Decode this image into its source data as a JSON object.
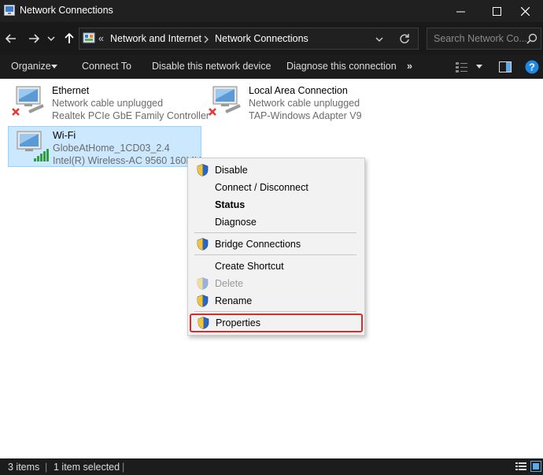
{
  "window": {
    "title": "Network Connections",
    "icon": "network-connections-icon",
    "controls": [
      "minimize-icon",
      "maximize-icon",
      "close-icon"
    ]
  },
  "address_bar": {
    "overflow": "«",
    "crumbs": [
      "Network and Internet",
      "Network Connections"
    ],
    "search_placeholder": "Search Network Co..."
  },
  "toolbar": {
    "organize": "Organize",
    "connect_to": "Connect To",
    "disable": "Disable this network device",
    "diagnose": "Diagnose this connection",
    "more": "»"
  },
  "items": [
    {
      "name": "Ethernet",
      "status": "Network cable unplugged",
      "adapter": "Realtek PCIe GbE Family Controller",
      "state": "disconnected"
    },
    {
      "name": "Local Area Connection",
      "status": "Network cable unplugged",
      "adapter": "TAP-Windows Adapter V9",
      "state": "disconnected"
    },
    {
      "name": "Wi-Fi",
      "status": "GlobeAtHome_1CD03_2.4",
      "adapter": "Intel(R) Wireless-AC 9560 160MHz",
      "state": "connected",
      "selected": true
    }
  ],
  "context_menu": {
    "items": [
      {
        "label": "Disable",
        "icon": "shield-icon"
      },
      {
        "label": "Connect / Disconnect"
      },
      {
        "label": "Status",
        "bold": true
      },
      {
        "label": "Diagnose"
      },
      {
        "label": "Bridge Connections",
        "icon": "shield-icon"
      },
      {
        "label": "Create Shortcut"
      },
      {
        "label": "Delete",
        "icon": "shield-icon",
        "disabled": true
      },
      {
        "label": "Rename",
        "icon": "shield-icon"
      },
      {
        "label": "Properties",
        "icon": "shield-icon",
        "highlighted": true
      }
    ]
  },
  "status_bar": {
    "count": "3 items",
    "selected": "1 item selected"
  },
  "colors": {
    "title_bar": "#202020",
    "toolbar": "#1c1c1c",
    "selection": "#cce8ff",
    "highlight_border": "#d32f2f",
    "help": "#1e88e5"
  }
}
